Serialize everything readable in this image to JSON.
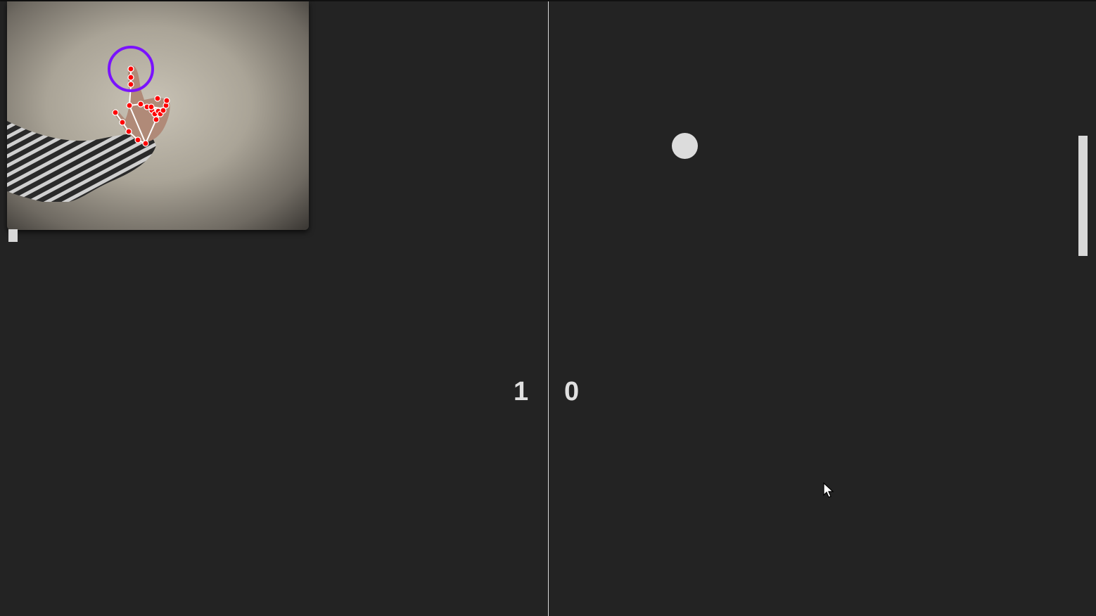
{
  "scoreboard": {
    "left_score": "1",
    "right_score": "0"
  },
  "webcam": {
    "hand_landmarks_count": 21,
    "fingertip_marker_color": "#7a12ff",
    "landmark_color": "#ff0000",
    "connection_color": "#ffffff"
  },
  "colors": {
    "background": "#232323",
    "foreground": "#dcdcdc"
  },
  "icons": {
    "cursor": "mouse-pointer-icon"
  }
}
